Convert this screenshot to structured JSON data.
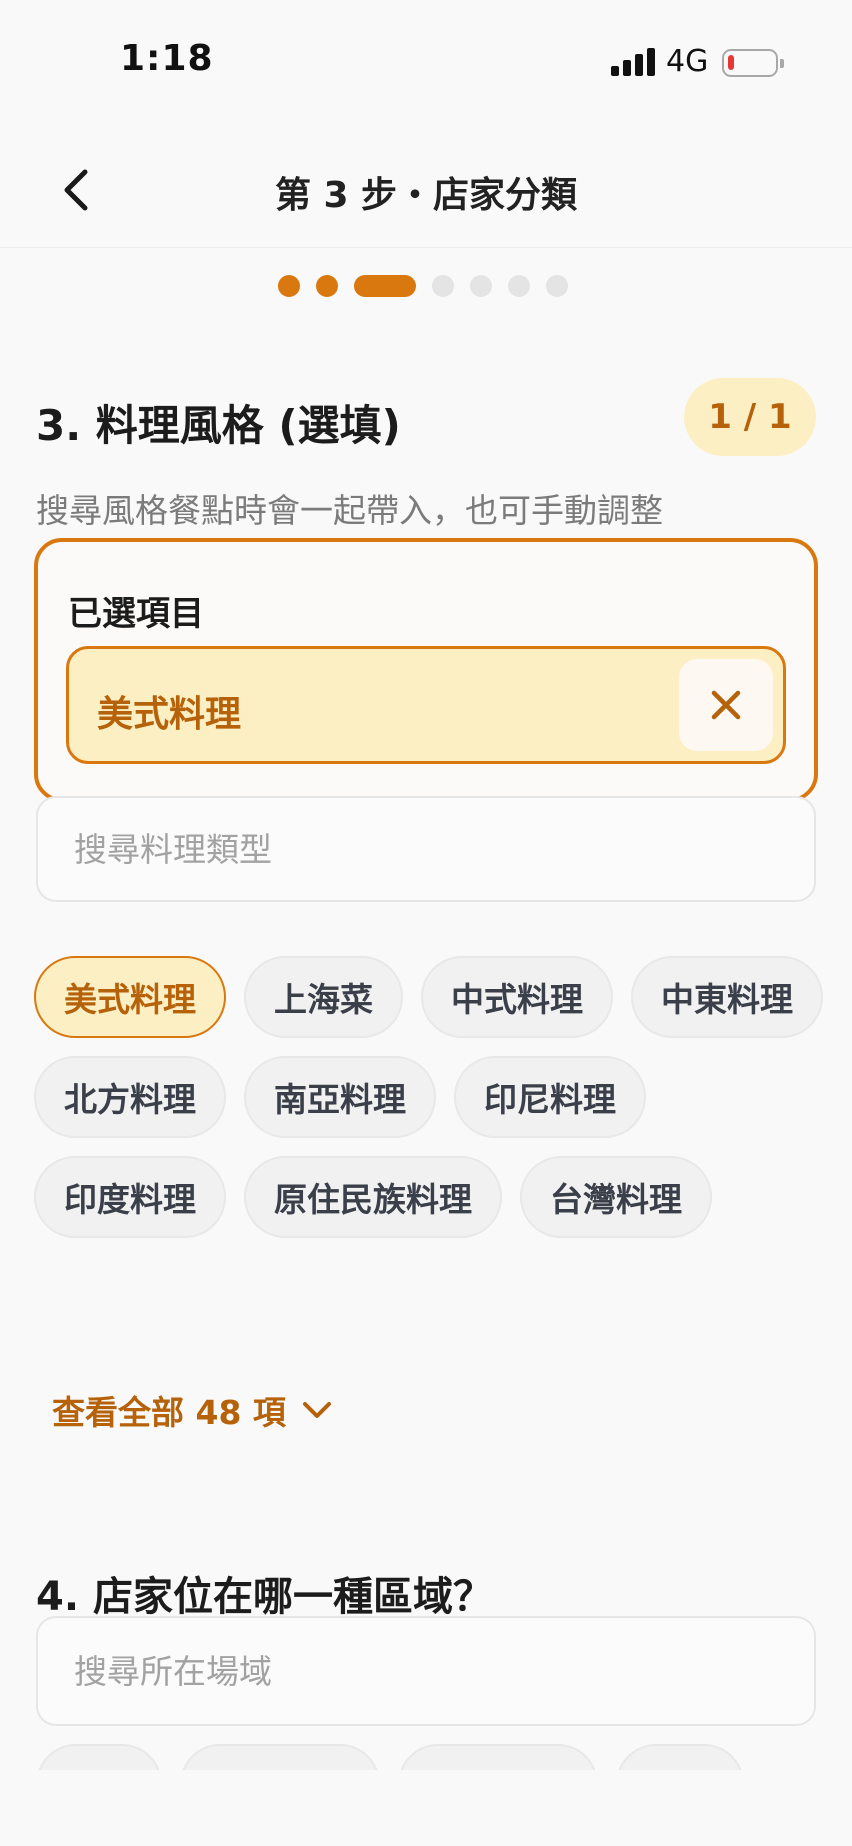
{
  "status_bar": {
    "time": "1:18",
    "network": "4G",
    "battery_level": 0.1
  },
  "header": {
    "title": "第 3 步・店家分類",
    "back_icon": "chevron-left-icon"
  },
  "progress": {
    "total_steps": 7,
    "current_step": 3
  },
  "section3": {
    "title": "3. 料理風格 (選填)",
    "count_badge": "1 / 1",
    "description": "搜尋風格餐點時會一起帶入，也可手動調整",
    "selected_label": "已選項目",
    "selected_items": [
      "美式料理"
    ],
    "remove_icon": "close-icon",
    "search_placeholder": "搜尋料理類型",
    "options": [
      {
        "label": "美式料理",
        "selected": true
      },
      {
        "label": "上海菜",
        "selected": false
      },
      {
        "label": "中式料理",
        "selected": false
      },
      {
        "label": "中東料理",
        "selected": false
      },
      {
        "label": "北方料理",
        "selected": false
      },
      {
        "label": "南亞料理",
        "selected": false
      },
      {
        "label": "印尼料理",
        "selected": false
      },
      {
        "label": "印度料理",
        "selected": false
      },
      {
        "label": "原住民族料理",
        "selected": false
      },
      {
        "label": "台灣料理",
        "selected": false
      }
    ],
    "see_all_label": "查看全部 48 項",
    "see_all_icon": "chevron-down-icon"
  },
  "section4": {
    "title": "4. 店家位在哪一種區域？",
    "search_placeholder": "搜尋所在場域"
  },
  "colors": {
    "accent": "#d9780f",
    "accent_text": "#b5620a",
    "accent_bg": "#fdefc4",
    "inactive_dot": "#e4e4e4",
    "battery_low": "#e53935"
  }
}
